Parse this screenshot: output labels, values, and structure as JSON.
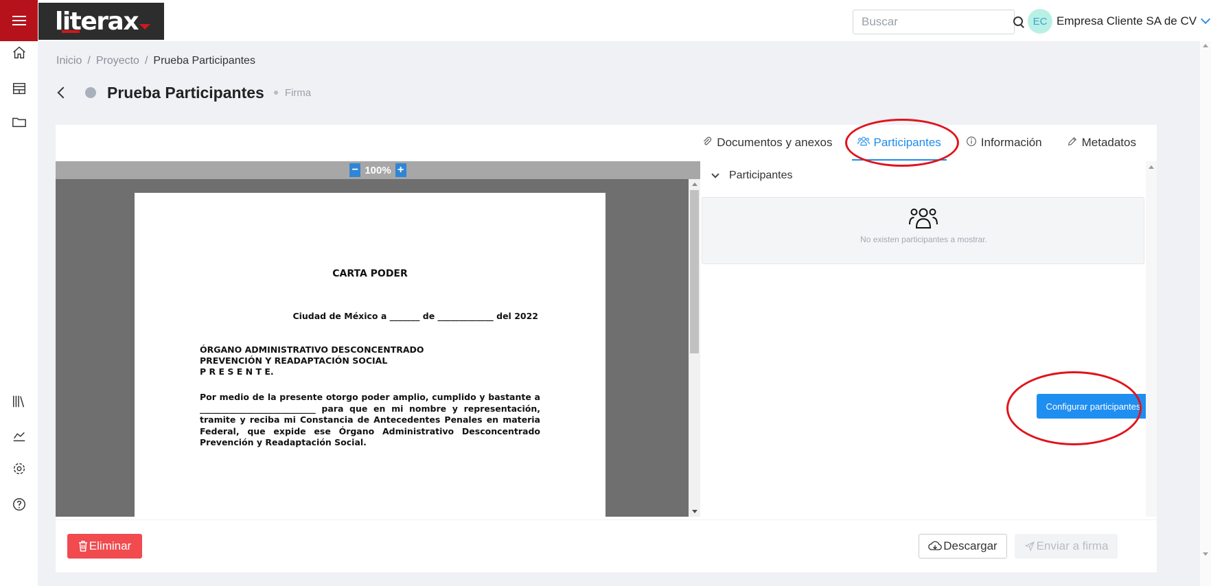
{
  "app": {
    "logo_text": "literax"
  },
  "header": {
    "search_placeholder": "Buscar",
    "user_initials": "EC",
    "user_name": "Empresa Cliente SA de CV"
  },
  "sidebar": {
    "icons": [
      "home-icon",
      "table-icon",
      "folder-icon",
      "library-icon",
      "chart-icon",
      "gear-icon",
      "help-icon"
    ]
  },
  "breadcrumb": {
    "items": [
      "Inicio",
      "Proyecto",
      "Prueba Participantes"
    ]
  },
  "page": {
    "title": "Prueba Participantes",
    "subtitle": "Firma"
  },
  "tabs": [
    {
      "label": "Documentos y anexos",
      "icon": "paperclip-icon"
    },
    {
      "label": "Participantes",
      "icon": "users-icon",
      "active": true
    },
    {
      "label": "Información",
      "icon": "info-icon"
    },
    {
      "label": "Metadatos",
      "icon": "pencil-icon"
    }
  ],
  "viewer": {
    "zoom": "100%",
    "document": {
      "title": "CARTA PODER",
      "date_line": "Ciudad de México a _______ de _____________ del 2022",
      "addressee": [
        "ÓRGANO ADMINISTRATIVO DESCONCENTRADO",
        "PREVENCIÓN Y READAPTACIÓN SOCIAL",
        "P R E S E N T E."
      ],
      "body": "Por medio de la presente otorgo poder amplio, cumplido y bastante a ___________________________ para que en mi nombre y representación, tramite y reciba mi Constancia de Antecedentes Penales en materia Federal, que expide ese Órgano Administrativo Desconcentrado Prevención y Readaptación Social."
    }
  },
  "participants_panel": {
    "section_title": "Participantes",
    "empty_message": "No existen participantes a mostrar.",
    "configure_button": "Configurar participantes"
  },
  "footer": {
    "delete_label": "Eliminar",
    "download_label": "Descargar",
    "send_label": "Enviar a firma"
  },
  "colors": {
    "brand": "#b5121b",
    "accent": "#1f8ef1",
    "danger": "#f14a4f",
    "annotation": "#e0141b"
  }
}
